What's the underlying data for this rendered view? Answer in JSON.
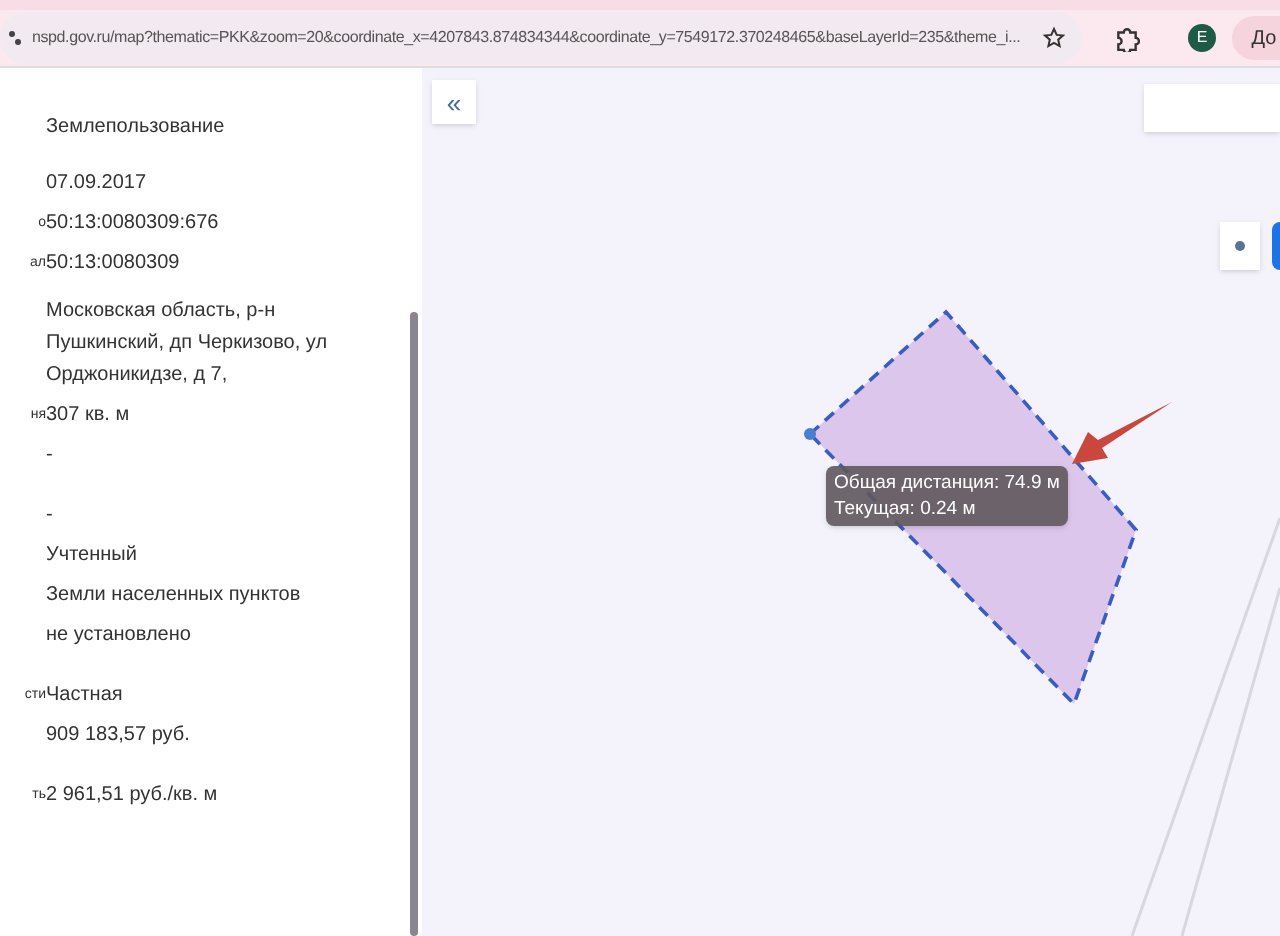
{
  "browser": {
    "url": "nspd.gov.ru/map?thematic=PKK&zoom=20&coordinate_x=4207843.874834344&coordinate_y=7549172.370248465&baseLayerId=235&theme_i...",
    "profile_initial": "Е",
    "action_label": "До"
  },
  "panel": {
    "rows": [
      {
        "label": "",
        "value": "Землепользование"
      },
      {
        "label": "",
        "value": "07.09.2017"
      },
      {
        "label": "о",
        "value": "50:13:0080309:676"
      },
      {
        "label": "ал",
        "value": "50:13:0080309"
      },
      {
        "label": "",
        "value": "Московская область, р-н Пушкинский, дп Черкизово, ул Орджоникидзе, д 7,"
      },
      {
        "label": "ня",
        "value": "307 кв. м"
      },
      {
        "label": "",
        "value": "-"
      },
      {
        "label": "",
        "value": "-"
      },
      {
        "label": "",
        "value": "Учтенный"
      },
      {
        "label": "",
        "value": "Земли населенных пунктов"
      },
      {
        "label": "",
        "value": "не установлено"
      },
      {
        "label": "сти",
        "value": "Частная"
      },
      {
        "label": "",
        "value": "909 183,57 руб."
      },
      {
        "label": "ть",
        "value": "2 961,51 руб./кв. м"
      }
    ]
  },
  "map": {
    "collapse_symbol": "«",
    "tooltip": [
      "Общая дистанция: 74.9 м",
      "Текущая: 0.24 м"
    ]
  }
}
